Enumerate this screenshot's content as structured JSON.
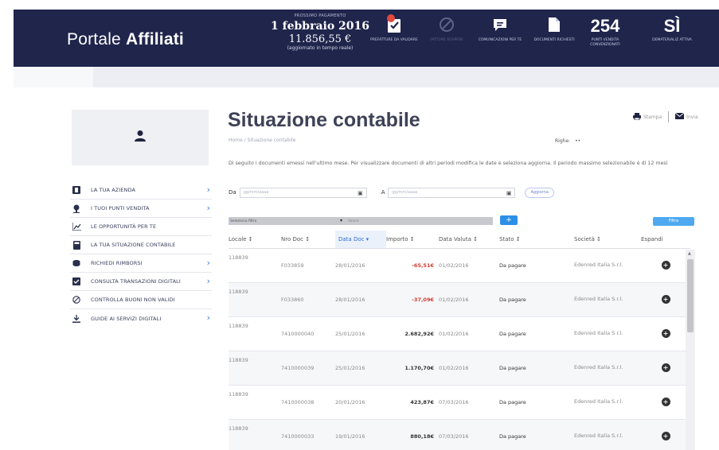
{
  "app": {
    "brand_light": "Portale ",
    "brand_bold": "Affiliati"
  },
  "payment": {
    "label": "PROSSIMO PAGAMENTO",
    "date": "1 febbraio 2016",
    "amount": "11.856,55 €",
    "note": "(aggiornato in tempo reale)"
  },
  "header_items": [
    {
      "icon": "checklist-icon",
      "caption": "PREFATTURE DA VALIDARE"
    },
    {
      "icon": "blocked-icon",
      "caption": "FATTURE SOSPESE"
    },
    {
      "icon": "chat-icon",
      "caption": "COMUNICAZIONI PER TE"
    },
    {
      "icon": "document-icon",
      "caption": "DOCUMENTI RICHIESTI"
    },
    {
      "value": "254",
      "caption": "PUNTI VENDITA CONVENZIONATI"
    },
    {
      "value": "SÌ",
      "caption": "DEMATERIALIZ ATTIVA"
    }
  ],
  "sidebar": {
    "items": [
      {
        "label": "LA TUA AZIENDA",
        "icon": "building-icon",
        "chevron": true
      },
      {
        "label": "I TUOI PUNTI VENDITA",
        "icon": "pin-icon",
        "chevron": true
      },
      {
        "label": "LE OPPORTUNITÀ PER TE",
        "icon": "trend-chart-icon",
        "chevron": false
      },
      {
        "label": "LA TUA SITUAZIONE CONTABILE",
        "icon": "calculator-icon",
        "chevron": false
      },
      {
        "label": "RICHIEDI RIMBORSI",
        "icon": "coins-icon",
        "chevron": true
      },
      {
        "label": "CONSULTA TRANSAZIONI DIGITALI",
        "icon": "card-icon",
        "chevron": true
      },
      {
        "label": "CONTROLLA BUONI NON VALIDI",
        "icon": "blocked-icon",
        "chevron": false
      },
      {
        "label": "GUIDE AI SERVIZI DIGITALI",
        "icon": "download-icon",
        "chevron": true
      }
    ]
  },
  "main": {
    "title": "Situazione contabile",
    "breadcrumb": "Home  /  Situazione contabile",
    "print_label": "Stampa",
    "email_label": "Invia",
    "rows_label": "Righe:",
    "rows_value": "••",
    "description": "Di seguito i documenti emessi nell'ultimo mese. Per visualizzare documenti di altri periodi modifica le date e seleziona aggiorna. Il periodo massimo selezionabile è di 12 mesi",
    "from_label": "Da",
    "to_label": "A",
    "date_placeholder": "gg/mm/aaaa",
    "refresh_label": "Aggiorna",
    "filter_select": "Seleziona filtro",
    "filter_value": "Valore",
    "add_filter": "+",
    "apply_filter": "Filtra"
  },
  "table": {
    "columns": [
      "Locale ↕",
      "Nro Doc ↕",
      "Data Doc ▾",
      "Importo ↕",
      "Data Valuta ↕",
      "Stato ↕",
      "Società ↕",
      "Espandi"
    ],
    "rows": [
      {
        "locale": "118839",
        "nro": "F033859",
        "data": "28/01/2016",
        "importo": "-65,51€",
        "neg": true,
        "valuta": "01/02/2016",
        "stato": "Da pagare",
        "societa": "Edenred Italia S.r.l."
      },
      {
        "locale": "118839",
        "nro": "F033860",
        "data": "28/01/2016",
        "importo": "-37,09€",
        "neg": true,
        "valuta": "01/02/2016",
        "stato": "Da pagare",
        "societa": "Edenred Italia S.r.l."
      },
      {
        "locale": "118839",
        "nro": "7410000040",
        "data": "25/01/2016",
        "importo": "2.682,92€",
        "neg": false,
        "valuta": "01/02/2016",
        "stato": "Da pagare",
        "societa": "Edenred Italia S.r.l."
      },
      {
        "locale": "118839",
        "nro": "7410000039",
        "data": "25/01/2016",
        "importo": "1.170,70€",
        "neg": false,
        "valuta": "01/02/2016",
        "stato": "Da pagare",
        "societa": "Edenred Italia S.r.l."
      },
      {
        "locale": "118839",
        "nro": "7410000038",
        "data": "20/01/2016",
        "importo": "423,87€",
        "neg": false,
        "valuta": "07/03/2016",
        "stato": "Da pagare",
        "societa": "Edenred Italia S.r.l."
      },
      {
        "locale": "118839",
        "nro": "7410000033",
        "data": "19/01/2016",
        "importo": "880,18€",
        "neg": false,
        "valuta": "07/03/2016",
        "stato": "Da pagare",
        "societa": "Edenred Italia S.r.l."
      }
    ]
  },
  "colors": {
    "header_bg": "#20254c",
    "accent_blue": "#2d8ee6",
    "negative_red": "#d23b2f",
    "badge_red": "#e04a3f"
  }
}
